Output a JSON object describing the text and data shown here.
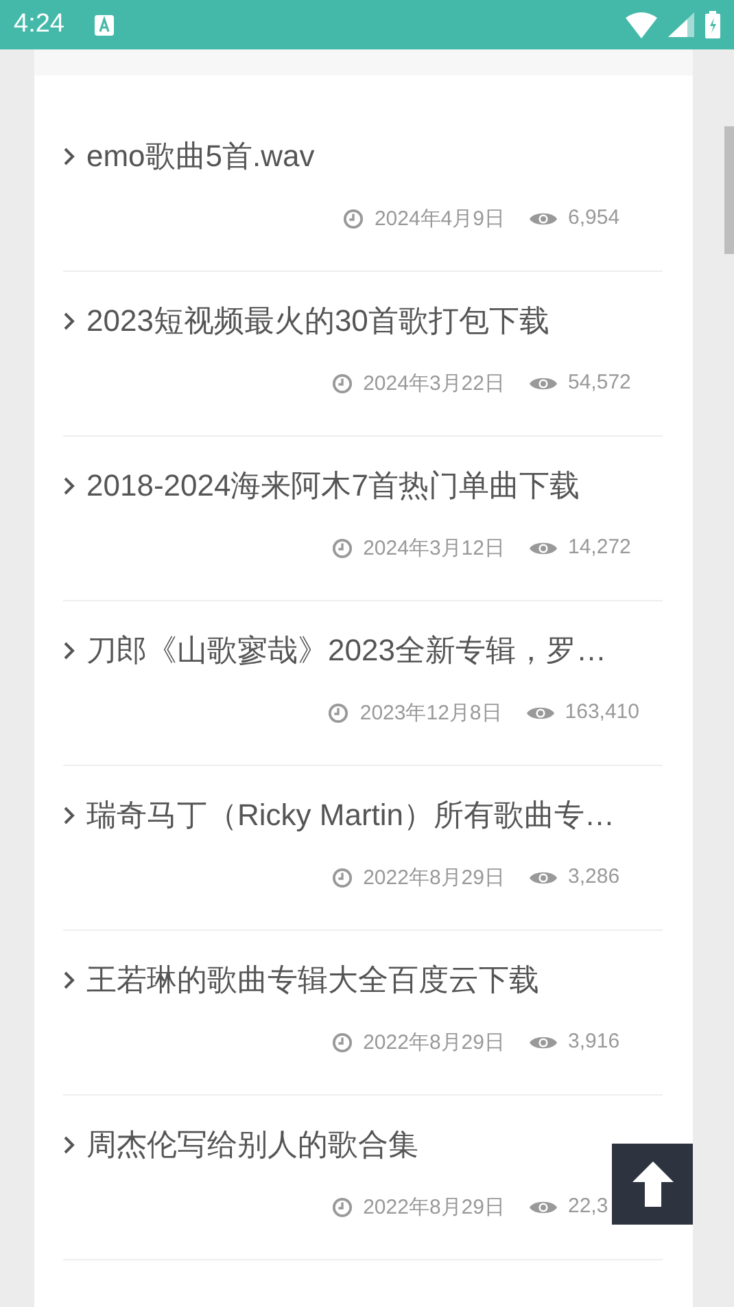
{
  "status_bar": {
    "time": "4:24"
  },
  "posts": [
    {
      "title": "emo歌曲5首.wav",
      "date": "2024年4月9日",
      "views": "6,954"
    },
    {
      "title": "2023短视频最火的30首歌打包下载",
      "date": "2024年3月22日",
      "views": "54,572"
    },
    {
      "title": "2018-2024海来阿木7首热门单曲下载",
      "date": "2024年3月12日",
      "views": "14,272"
    },
    {
      "title": "刀郎《山歌寥哉》2023全新专辑，罗…",
      "date": "2023年12月8日",
      "views": "163,410"
    },
    {
      "title": "瑞奇马丁（Ricky Martin）所有歌曲专…",
      "date": "2022年8月29日",
      "views": "3,286"
    },
    {
      "title": "王若琳的歌曲专辑大全百度云下载",
      "date": "2022年8月29日",
      "views": "3,916"
    },
    {
      "title": "周杰伦写给别人的歌合集",
      "date": "2022年8月29日",
      "views": "22,3"
    }
  ]
}
